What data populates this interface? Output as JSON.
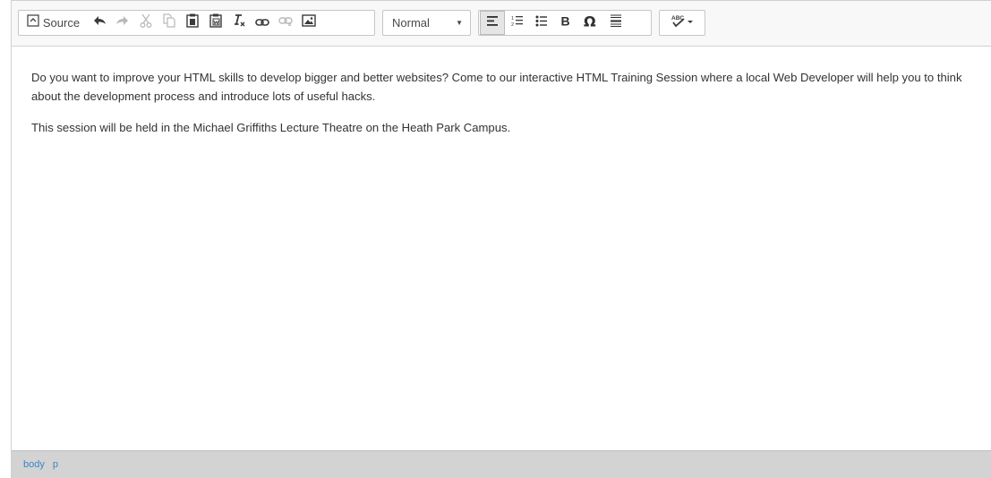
{
  "toolbar": {
    "source_label": "Source",
    "format_value": "Normal",
    "buttons": [
      "source-icon",
      "undo-icon",
      "redo-icon",
      "cut-icon",
      "copy-icon",
      "paste-icon",
      "paste-from-word-icon",
      "remove-format-icon",
      "link-icon",
      "unlink-icon",
      "image-icon",
      "align-left-icon",
      "numbered-list-icon",
      "bulleted-list-icon",
      "bold-icon",
      "special-character-icon",
      "horizontal-line-icon",
      "spellcheck-icon"
    ]
  },
  "content": {
    "paragraphs": [
      "Do you want to improve your HTML skills to develop bigger and better websites? Come to our interactive HTML Training Session where a local Web Developer will help you to think about the development process and introduce lots of useful hacks.",
      "This session will be held in the Michael Griffiths Lecture Theatre on the Heath Park Campus."
    ]
  },
  "statusbar": {
    "path": [
      "body",
      "p"
    ]
  },
  "colors": {
    "toolbar_bg": "#f8f8f8",
    "status_bg": "#d3d3d3",
    "path_link": "#3a87c7",
    "text": "#333333"
  }
}
